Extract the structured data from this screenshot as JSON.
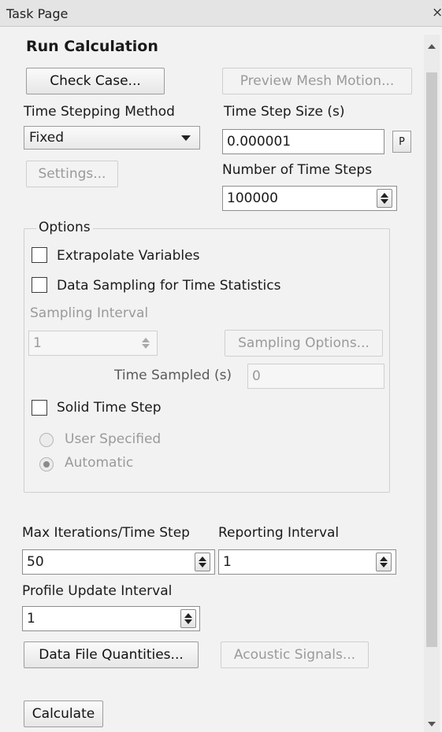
{
  "window": {
    "title": "Task Page",
    "close": "×"
  },
  "panel": {
    "heading": "Run Calculation",
    "check_case": "Check Case...",
    "preview_mesh_motion": "Preview Mesh Motion...",
    "time_stepping_method": {
      "label": "Time Stepping Method",
      "value": "Fixed"
    },
    "time_step_size": {
      "label": "Time Step Size (s)",
      "value": "0.000001",
      "param_button": "P"
    },
    "settings": "Settings...",
    "number_of_time_steps": {
      "label": "Number of Time Steps",
      "value": "100000"
    },
    "options": {
      "legend": "Options",
      "extrapolate_variables": {
        "label": "Extrapolate Variables",
        "checked": false
      },
      "data_sampling": {
        "label": "Data Sampling for Time Statistics",
        "checked": false
      },
      "sampling_interval": {
        "label": "Sampling Interval",
        "value": "1"
      },
      "sampling_options": "Sampling Options...",
      "time_sampled": {
        "label": "Time Sampled (s)",
        "value": "0"
      },
      "solid_time_step": {
        "label": "Solid Time Step",
        "checked": false
      },
      "user_specified": {
        "label": "User Specified",
        "selected": false
      },
      "automatic": {
        "label": "Automatic",
        "selected": true
      }
    },
    "max_iterations": {
      "label": "Max Iterations/Time Step",
      "value": "50"
    },
    "reporting_interval": {
      "label": "Reporting Interval",
      "value": "1"
    },
    "profile_update_interval": {
      "label": "Profile Update Interval",
      "value": "1"
    },
    "data_file_quantities": "Data File Quantities...",
    "acoustic_signals": "Acoustic Signals...",
    "calculate": "Calculate"
  }
}
